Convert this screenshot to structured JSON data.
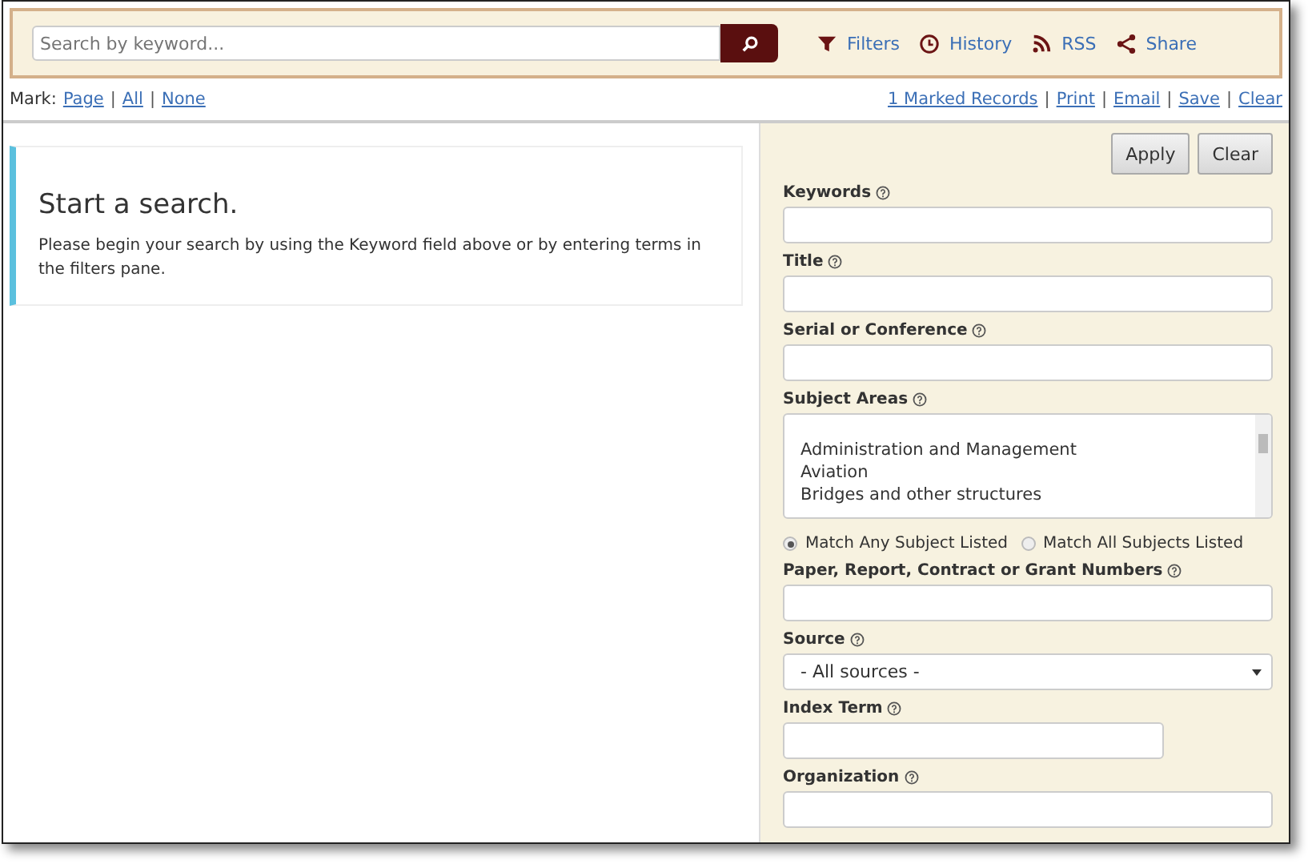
{
  "search": {
    "placeholder": "Search by keyword..."
  },
  "toolbar": [
    {
      "kind": "filter",
      "label": "Filters"
    },
    {
      "kind": "history",
      "label": "History"
    },
    {
      "kind": "rss",
      "label": "RSS"
    },
    {
      "kind": "share",
      "label": "Share"
    }
  ],
  "mark": {
    "label": "Mark:",
    "links": [
      {
        "kind": "link",
        "text": "Page"
      },
      {
        "kind": "separator",
        "text": "|"
      },
      {
        "kind": "link",
        "text": "All"
      },
      {
        "kind": "separator",
        "text": "|"
      },
      {
        "kind": "link",
        "text": "None"
      }
    ]
  },
  "record_links": [
    {
      "kind": "link",
      "text": "1 Marked Records"
    },
    {
      "kind": "separator",
      "text": "|"
    },
    {
      "kind": "link",
      "text": "Print"
    },
    {
      "kind": "separator",
      "text": "|"
    },
    {
      "kind": "link",
      "text": "Email"
    },
    {
      "kind": "separator",
      "text": "|"
    },
    {
      "kind": "link",
      "text": "Save"
    },
    {
      "kind": "separator",
      "text": "|"
    },
    {
      "kind": "link",
      "text": "Clear"
    }
  ],
  "message": {
    "title": "Start a search.",
    "body": "Please begin your search by using the Keyword field above or by entering terms in the filters pane."
  },
  "filter_buttons": [
    "Apply",
    "Clear"
  ],
  "filters": [
    {
      "kind": "text",
      "label": "Keywords"
    },
    {
      "kind": "text",
      "label": "Title"
    },
    {
      "kind": "text",
      "label": "Serial or Conference"
    },
    {
      "kind": "list",
      "label": "Subject Areas",
      "options": [
        "Administration and Management",
        "Aviation",
        "Bridges and other structures"
      ]
    },
    {
      "kind": "radio",
      "options": [
        {
          "label": "Match Any Subject Listed",
          "selected": true
        },
        {
          "label": "Match All Subjects Listed",
          "selected": false
        }
      ]
    },
    {
      "kind": "text",
      "label": "Paper, Report, Contract or Grant Numbers"
    },
    {
      "kind": "select",
      "label": "Source",
      "value": "- All sources -"
    },
    {
      "kind": "short",
      "label": "Index Term"
    },
    {
      "kind": "text",
      "label": "Organization"
    }
  ]
}
